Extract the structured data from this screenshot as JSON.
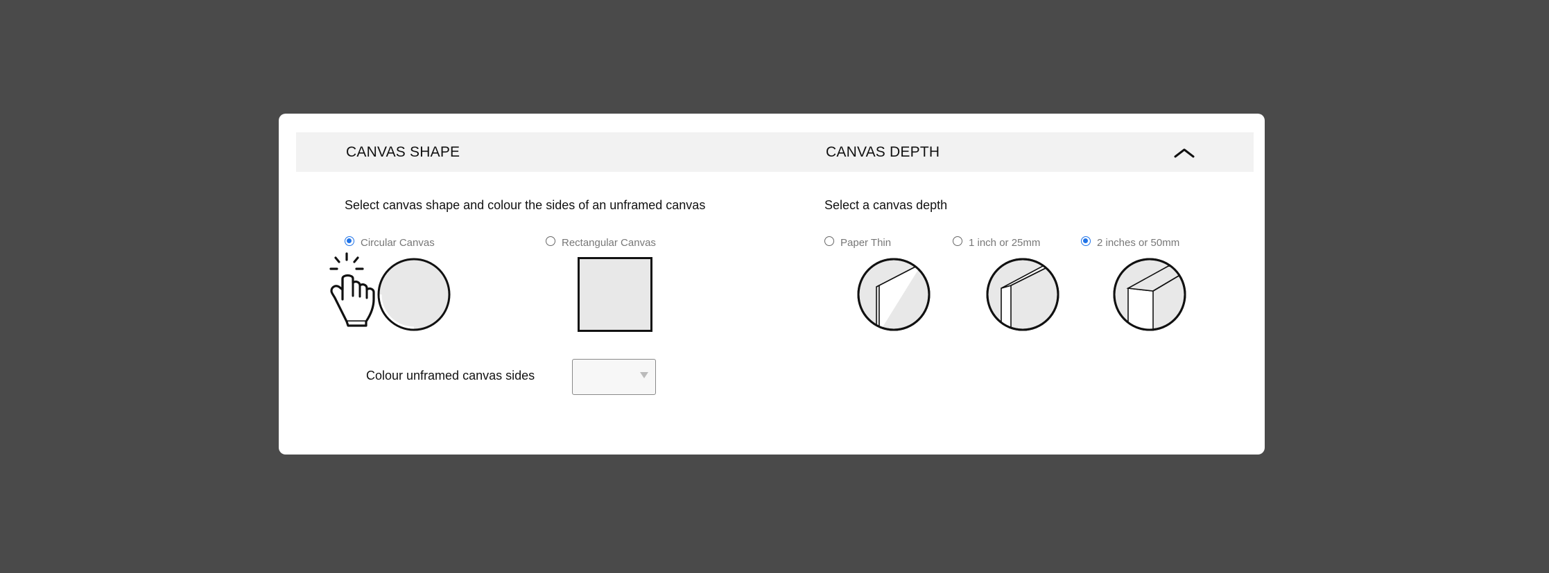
{
  "header": {
    "shape_title": "CANVAS SHAPE",
    "depth_title": "CANVAS DEPTH",
    "collapse_icon": "chevron-up-icon"
  },
  "shape": {
    "subtitle": "Select canvas shape and colour the sides of an unframed canvas",
    "options": [
      {
        "label": "Circular Canvas",
        "selected": true
      },
      {
        "label": "Rectangular Canvas",
        "selected": false
      }
    ],
    "colour_label": "Colour unframed canvas sides",
    "colour_value": ""
  },
  "depth": {
    "subtitle": "Select a canvas depth",
    "options": [
      {
        "label": "Paper Thin",
        "selected": false
      },
      {
        "label": "1 inch or 25mm",
        "selected": false
      },
      {
        "label": "2 inches or 50mm",
        "selected": true
      }
    ]
  },
  "colors": {
    "background": "#4a4a4a",
    "panel": "#ffffff",
    "header_bar": "#f2f2f2",
    "accent": "#1f73e8",
    "illustration_fill": "#e8e8e8"
  }
}
